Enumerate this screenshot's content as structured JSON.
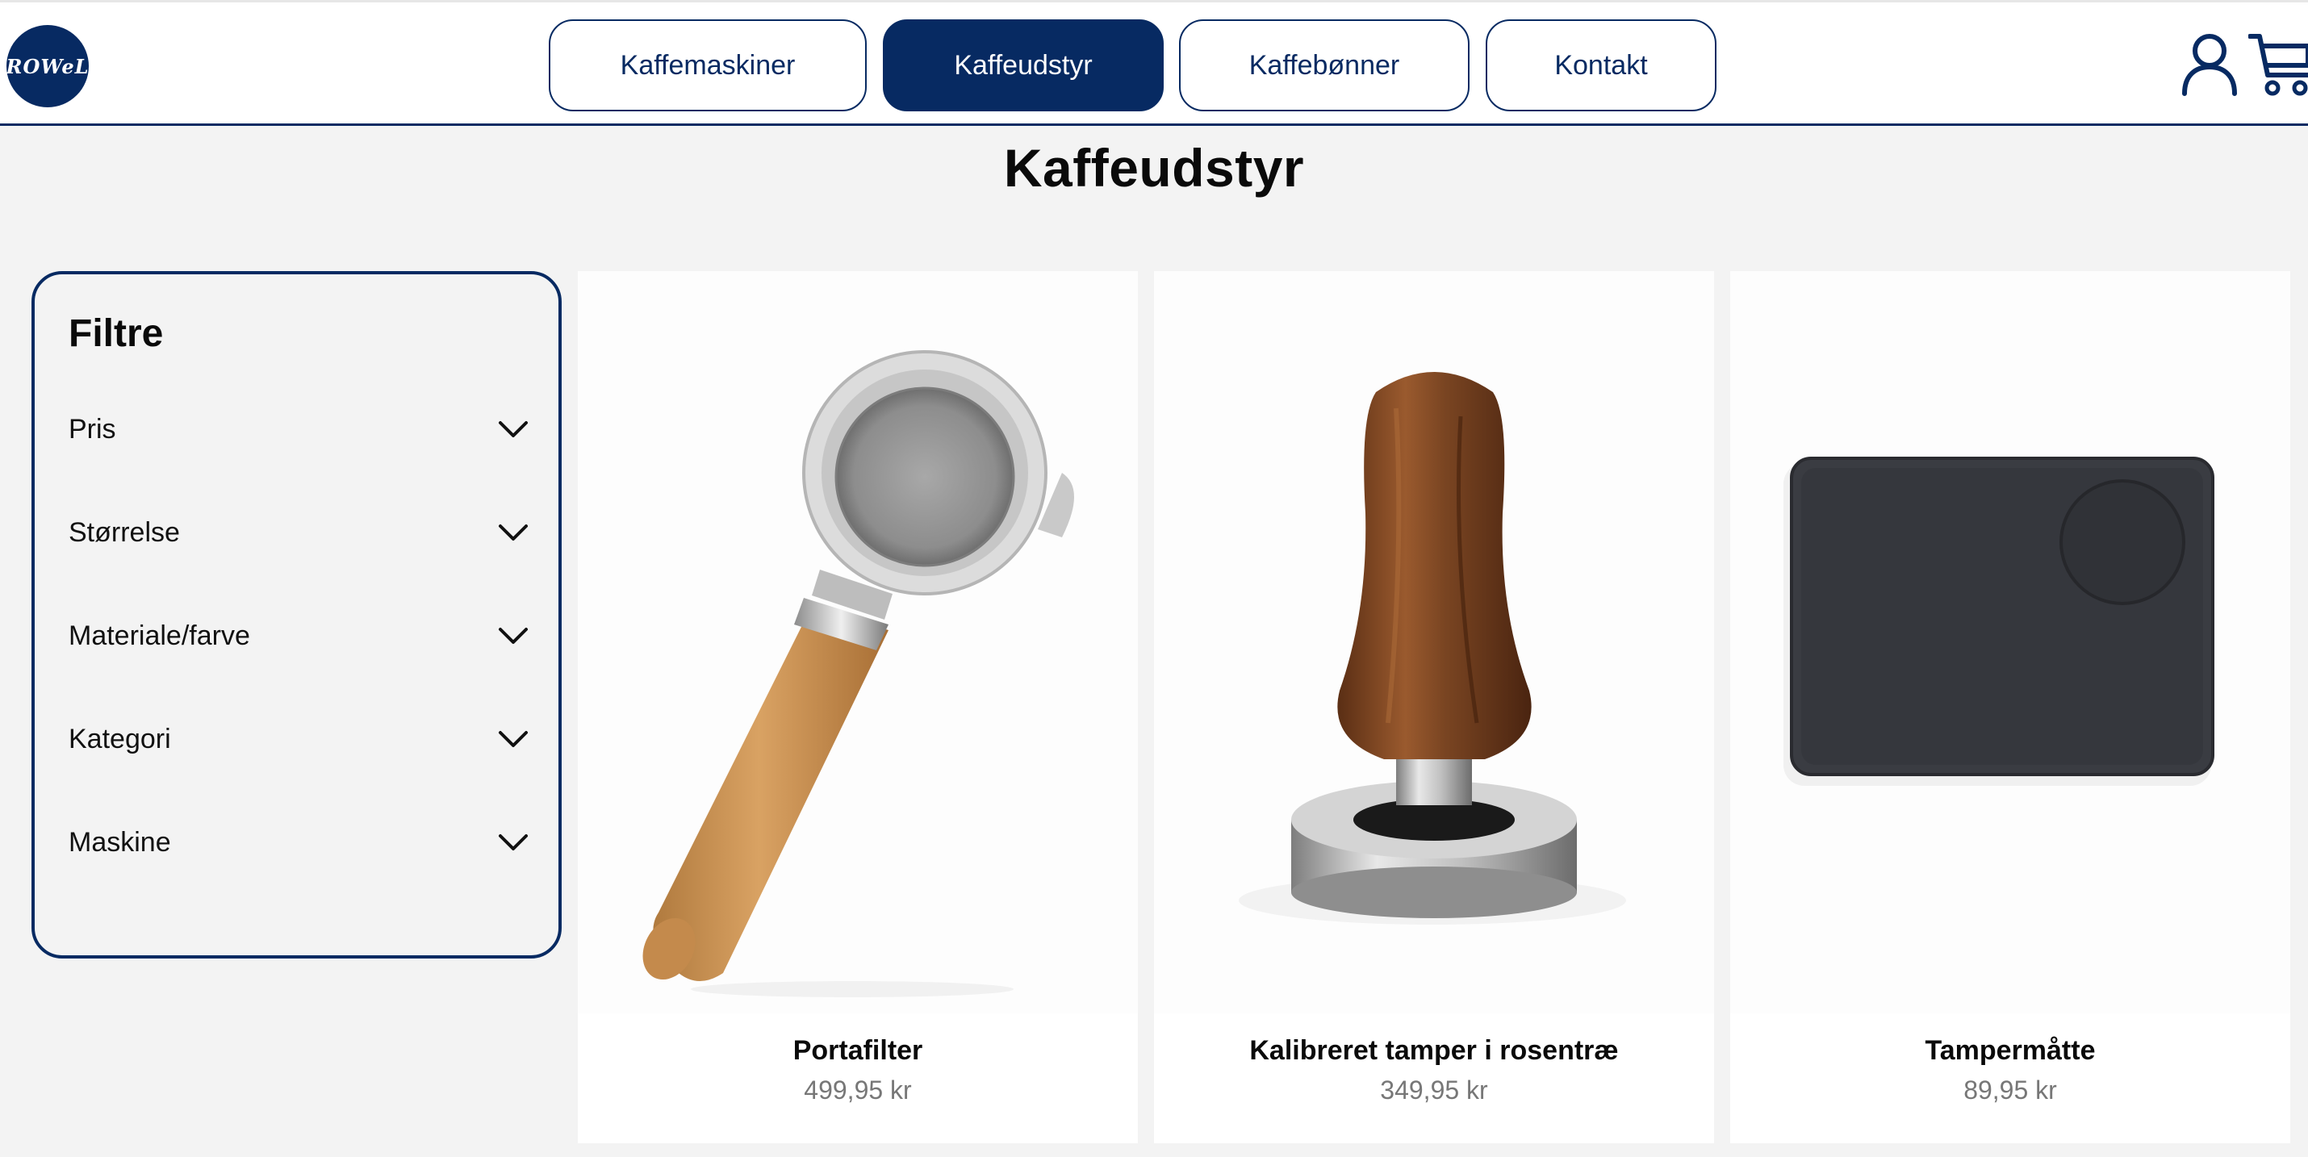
{
  "header": {
    "logo_text": "ROWeL",
    "nav": [
      {
        "label": "Kaffemaskiner",
        "active": false
      },
      {
        "label": "Kaffeudstyr",
        "active": true
      },
      {
        "label": "Kaffebønner",
        "active": false
      },
      {
        "label": "Kontakt",
        "active": false
      }
    ],
    "icons": [
      "user-icon",
      "cart-icon"
    ]
  },
  "page": {
    "title": "Kaffeudstyr"
  },
  "filters": {
    "title": "Filtre",
    "items": [
      {
        "label": "Pris"
      },
      {
        "label": "Størrelse"
      },
      {
        "label": "Materiale/farve"
      },
      {
        "label": "Kategori"
      },
      {
        "label": "Maskine"
      }
    ]
  },
  "products": [
    {
      "name": "Portafilter",
      "price": "499,95 kr",
      "image": "portafilter-image"
    },
    {
      "name": "Kalibreret tamper i rosentræ",
      "price": "349,95 kr",
      "image": "tamper-image"
    },
    {
      "name": "Tampermåtte",
      "price": "89,95 kr",
      "image": "tamper-mat-image"
    }
  ],
  "colors": {
    "brand": "#072a62",
    "background": "#f3f3f3",
    "card": "#ffffff",
    "price": "#777777"
  }
}
